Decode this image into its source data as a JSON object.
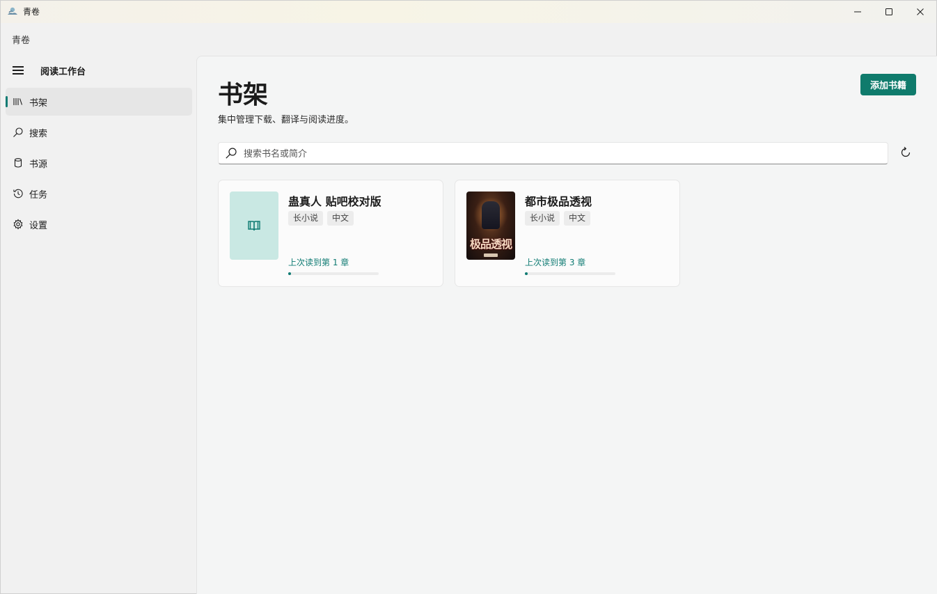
{
  "window": {
    "title": "青卷"
  },
  "app_header": "青卷",
  "sidebar": {
    "title": "阅读工作台",
    "items": [
      {
        "label": "书架",
        "icon": "bookshelf-icon",
        "active": true
      },
      {
        "label": "搜索",
        "icon": "search-icon",
        "active": false
      },
      {
        "label": "书源",
        "icon": "database-icon",
        "active": false
      },
      {
        "label": "任务",
        "icon": "history-icon",
        "active": false
      },
      {
        "label": "设置",
        "icon": "gear-icon",
        "active": false
      }
    ]
  },
  "main": {
    "title": "书架",
    "subtitle": "集中管理下载、翻译与阅读进度。",
    "add_button": "添加书籍",
    "search": {
      "placeholder": "搜索书名或简介",
      "value": ""
    }
  },
  "books": [
    {
      "title": "蛊真人 贴吧校对版",
      "tags": [
        "长小说",
        "中文"
      ],
      "progress_label": "上次读到第 1 章",
      "progress_fraction": 0.02,
      "cover": "placeholder-book-icon"
    },
    {
      "title": "都市极品透视",
      "tags": [
        "长小说",
        "中文"
      ],
      "progress_label": "上次读到第 3 章",
      "progress_fraction": 0.02,
      "cover": "cover-image",
      "cover_text": "极品透视",
      "cover_small_text": "都市"
    }
  ],
  "colors": {
    "accent": "#0f7b73",
    "button": "#0f7b6c",
    "cover_placeholder": "#c9e8e3"
  }
}
